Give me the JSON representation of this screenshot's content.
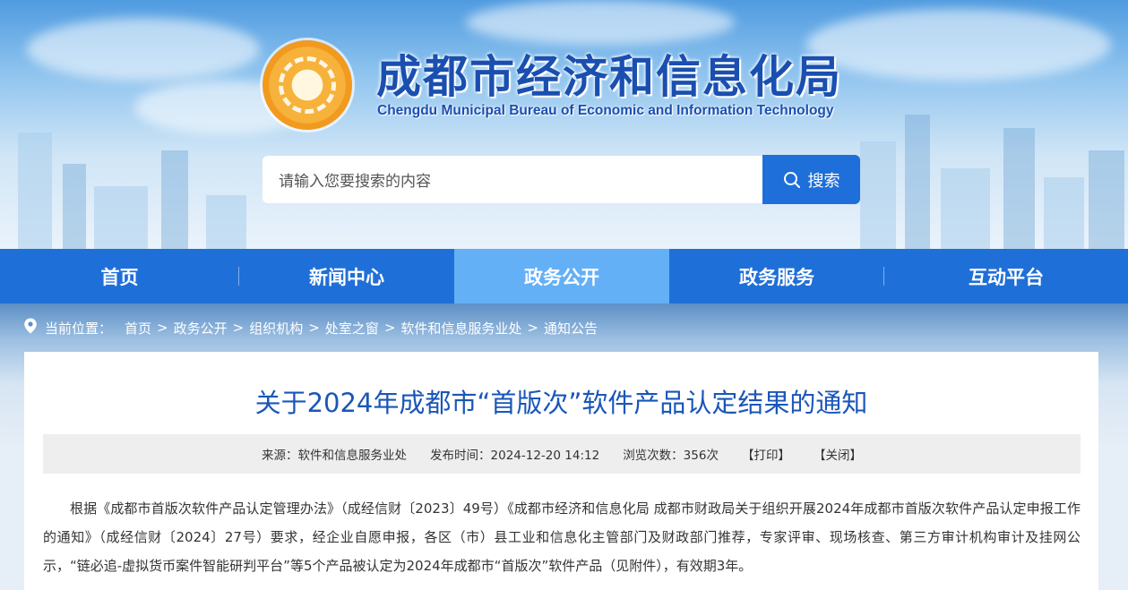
{
  "header": {
    "title_cn": "成都市经济和信息化局",
    "title_en": "Chengdu Municipal Bureau of Economic and Information Technology",
    "logo_icon": "city-emblem-icon"
  },
  "search": {
    "placeholder": "请输入您要搜索的内容",
    "button_label": "搜索",
    "button_icon": "search-icon"
  },
  "nav": {
    "items": [
      {
        "label": "首页"
      },
      {
        "label": "新闻中心"
      },
      {
        "label": "政务公开"
      },
      {
        "label": "政务服务"
      },
      {
        "label": "互动平台"
      }
    ],
    "active_index": 2
  },
  "breadcrumb": {
    "icon": "location-pin-icon",
    "label": "当前位置：",
    "separator": ">",
    "items": [
      "首页",
      "政务公开",
      "组织机构",
      "处室之窗",
      "软件和信息服务业处",
      "通知公告"
    ]
  },
  "article": {
    "title": "关于2024年成都市“首版次”软件产品认定结果的通知",
    "meta": {
      "source": "来源：软件和信息服务业处",
      "publish_time": "发布时间：2024-12-20 14:12",
      "views": "浏览次数：356次",
      "print": "【打印】",
      "close": "【关闭】"
    },
    "body": "根据《成都市首版次软件产品认定管理办法》（成经信财〔2023〕49号）《成都市经济和信息化局 成都市财政局关于组织开展2024年成都市首版次软件产品认定申报工作的通知》（成经信财〔2024〕27号）要求，经企业自愿申报，各区（市）县工业和信息化主管部门及财政部门推荐，专家评审、现场核查、第三方审计机构审计及挂网公示，“链必追-虚拟货币案件智能研判平台”等5个产品被认定为2024年成都市“首版次”软件产品（见附件），有效期3年。"
  },
  "colors": {
    "primary_blue": "#1f6fd8",
    "active_nav": "#63b0f6",
    "title_blue": "#1a56b8",
    "logo_orange": "#f29a1f"
  }
}
